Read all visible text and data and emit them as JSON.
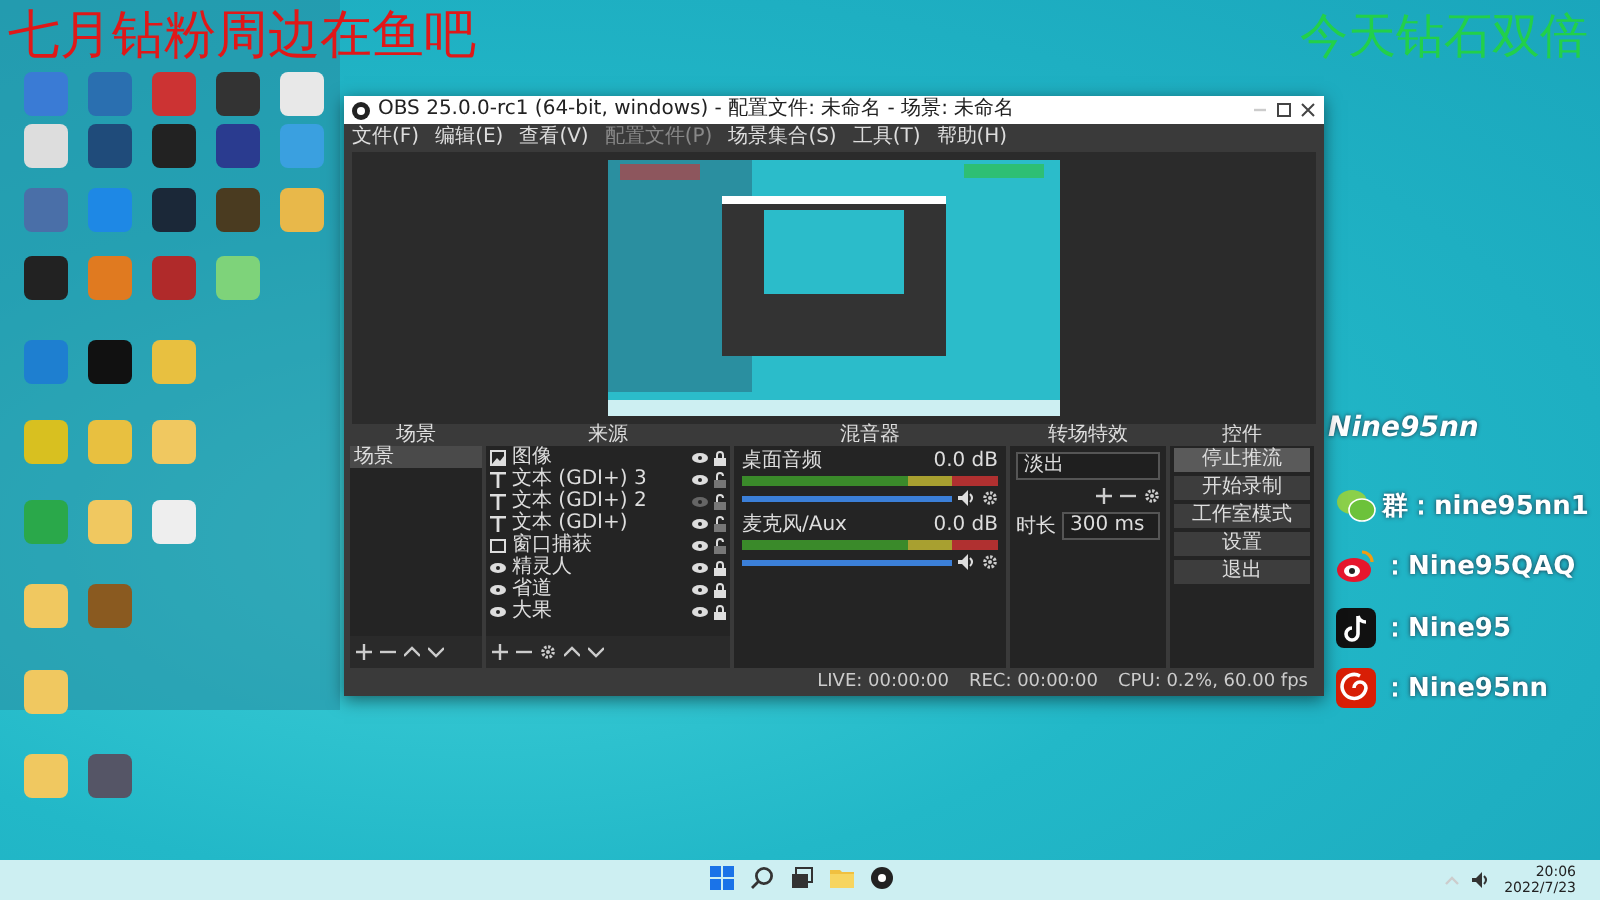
{
  "desktop_overlay": {
    "promo_text": "七月钻粉周边在鱼吧",
    "bonus_text": "今天钻石双倍"
  },
  "obs_window": {
    "title": "OBS 25.0.0-rc1 (64-bit, windows) - 配置文件: 未命名 - 场景: 未命名",
    "menu": [
      {
        "label": "文件(F)",
        "disabled": false
      },
      {
        "label": "编辑(E)",
        "disabled": false
      },
      {
        "label": "查看(V)",
        "disabled": false
      },
      {
        "label": "配置文件(P)",
        "disabled": true
      },
      {
        "label": "场景集合(S)",
        "disabled": false
      },
      {
        "label": "工具(T)",
        "disabled": false
      },
      {
        "label": "帮助(H)",
        "disabled": false
      }
    ],
    "docks": {
      "scenes": {
        "title": "场景",
        "items": [
          {
            "label": "场景",
            "selected": true
          }
        ]
      },
      "sources": {
        "title": "来源",
        "items": [
          {
            "label": "图像",
            "kind": "image",
            "visible": true,
            "locked": true
          },
          {
            "label": "文本 (GDI+) 3",
            "kind": "text",
            "visible": true,
            "locked": false
          },
          {
            "label": "文本 (GDI+) 2",
            "kind": "text",
            "visible": false,
            "locked": false
          },
          {
            "label": "文本 (GDI+)",
            "kind": "text",
            "visible": true,
            "locked": false
          },
          {
            "label": "窗口捕获",
            "kind": "window",
            "visible": true,
            "locked": false
          },
          {
            "label": "精灵人",
            "kind": "media",
            "visible": true,
            "locked": true
          },
          {
            "label": "省道",
            "kind": "media",
            "visible": true,
            "locked": true
          },
          {
            "label": "大果",
            "kind": "media",
            "visible": true,
            "locked": true
          }
        ]
      },
      "mixer": {
        "title": "混音器",
        "channels": [
          {
            "name": "桌面音频",
            "reading": "0.0 dB",
            "level": 1
          },
          {
            "name": "麦克风/Aux",
            "reading": "0.0 dB",
            "level": 1
          }
        ]
      },
      "transitions": {
        "title": "转场特效",
        "selected_transition": "淡出",
        "duration_label": "时长",
        "duration": "300 ms"
      },
      "controls": {
        "title": "控件",
        "buttons": [
          {
            "label": "停止推流",
            "active": true
          },
          {
            "label": "开始录制",
            "active": false
          },
          {
            "label": "工作室模式",
            "active": false
          },
          {
            "label": "设置",
            "active": false
          },
          {
            "label": "退出",
            "active": false
          }
        ]
      }
    },
    "status_bar": {
      "live": "LIVE: 00:00:00",
      "rec": "REC: 00:00:00",
      "cpu": "CPU: 0.2%, 60.00 fps"
    }
  },
  "social": {
    "handle": "Nine95nn",
    "accounts": [
      {
        "kind": "wechat",
        "text": "群：nine95nn1"
      },
      {
        "kind": "weibo",
        "text": "：Nine95QAQ"
      },
      {
        "kind": "tiktok",
        "text": "：Nine95"
      },
      {
        "kind": "netease",
        "text": "：Nine95nn"
      }
    ]
  },
  "taskbar": {
    "time": "20:06",
    "date": "2022/7/23"
  }
}
